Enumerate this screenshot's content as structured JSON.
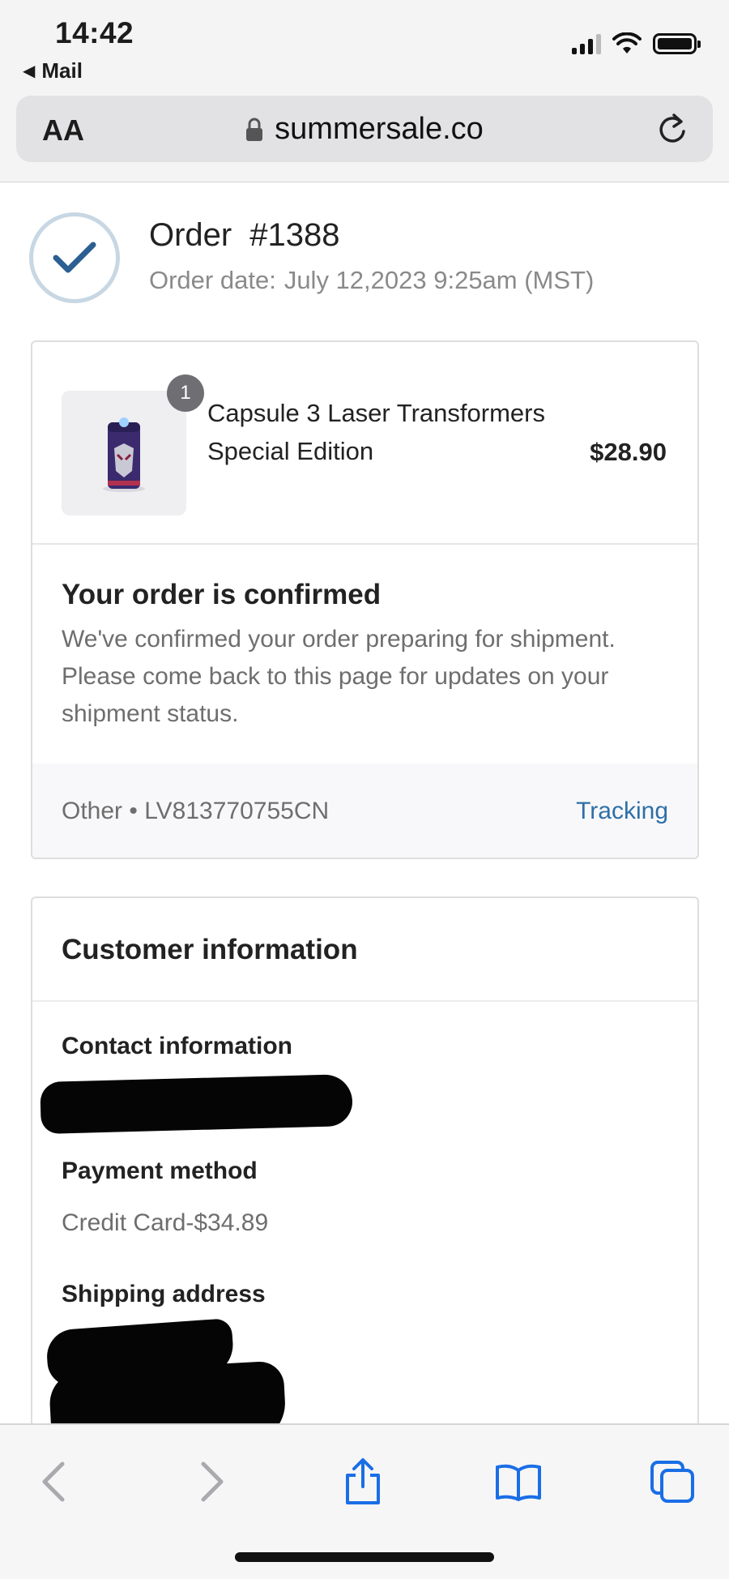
{
  "status_bar": {
    "time": "14:42",
    "back_app": "Mail"
  },
  "browser": {
    "text_size_label": "AA",
    "url": "summersale.co"
  },
  "order": {
    "title": "Order",
    "number": "#1388",
    "date_label": "Order date:",
    "date_value": "July 12,2023 9:25am (MST)",
    "status_icon": "checkmark-icon"
  },
  "product": {
    "quantity": "1",
    "name": "Capsule 3 Laser Transformers Special Edition",
    "price": "$28.90"
  },
  "confirmation": {
    "title": "Your order is confirmed",
    "message": "We've confirmed your order preparing for shipment. Please come back to this page for updates on your shipment status."
  },
  "shipment": {
    "carrier_and_number": "Other • LV813770755CN",
    "tracking_label": "Tracking"
  },
  "customer": {
    "heading": "Customer information",
    "contact_label": "Contact information",
    "payment_label": "Payment method",
    "payment_value": "Credit Card-$34.89",
    "shipping_label": "Shipping address"
  },
  "toolbar": {
    "icons": [
      "back-icon",
      "forward-icon",
      "share-icon",
      "bookmarks-icon",
      "tabs-icon"
    ]
  },
  "colors": {
    "accent_link": "#2f6fa7",
    "check_blue": "#2c5f92",
    "toolbar_blue": "#1a6ee6"
  }
}
